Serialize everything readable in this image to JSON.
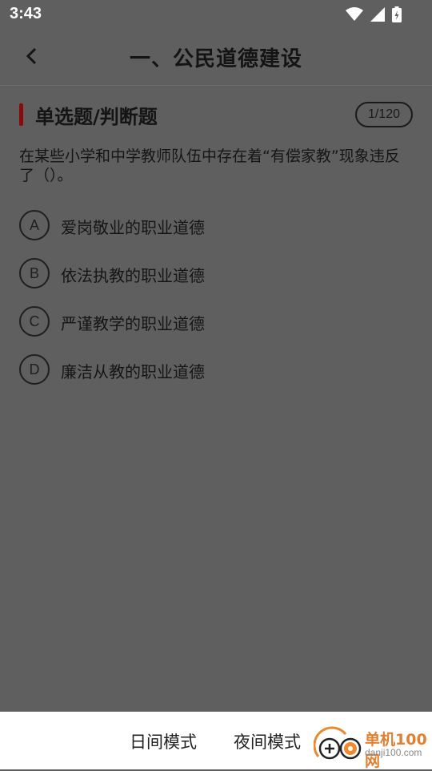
{
  "status_bar": {
    "time": "3:43"
  },
  "app_bar": {
    "title": "一、公民道德建设"
  },
  "section": {
    "title": "单选题/判断题",
    "counter": "1/120"
  },
  "question": {
    "text": "在某些小学和中学教师队伍中存在着“有偿家教”现象违反了（）。"
  },
  "options": [
    {
      "letter": "A",
      "text": "爱岗敬业的职业道德"
    },
    {
      "letter": "B",
      "text": "依法执教的职业道德"
    },
    {
      "letter": "C",
      "text": "严谨教学的职业道德"
    },
    {
      "letter": "D",
      "text": "廉洁从教的职业道德"
    }
  ],
  "bottom_bar": {
    "day_mode": "日间模式",
    "night_mode": "夜间模式"
  },
  "watermark": {
    "cn": "单机100网",
    "en": "danji100.com"
  },
  "colors": {
    "accent": "#8c0a0a",
    "overlay": "#5f5f5f",
    "bottom_bg": "#ffffff"
  },
  "icons": [
    "wifi-icon",
    "signal-icon",
    "battery-icon",
    "back-arrow-icon"
  ]
}
